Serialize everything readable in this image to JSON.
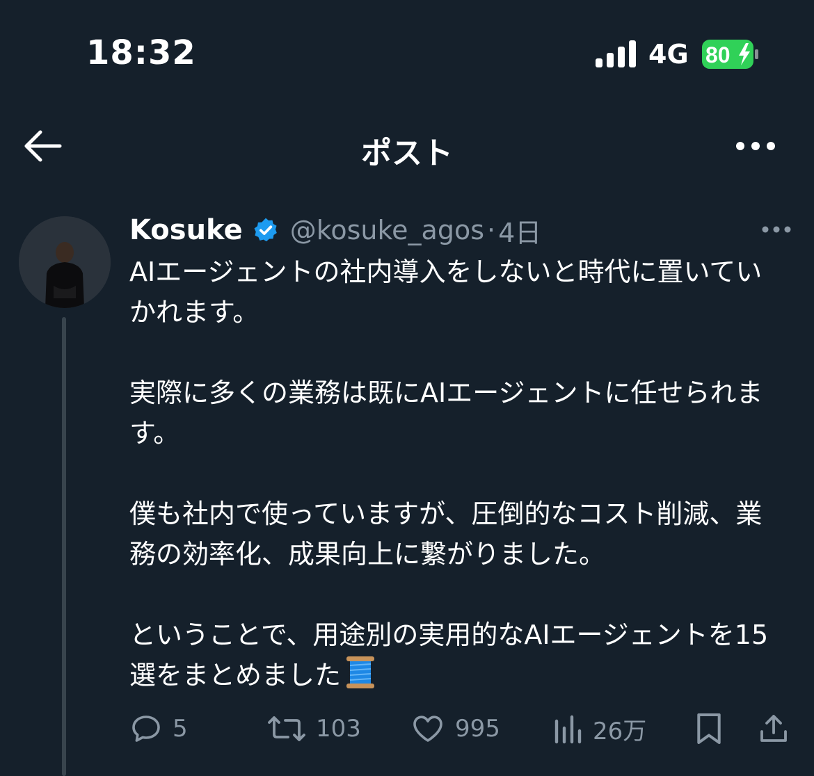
{
  "status_bar": {
    "time": "18:32",
    "network": "4G",
    "battery_level": "80",
    "battery_color": "#30d158"
  },
  "header": {
    "title": "ポスト",
    "back_icon": "arrow-left-icon",
    "more_icon": "more-horizontal-icon"
  },
  "post": {
    "author_name": "Kosuke",
    "verified_icon": "verified-badge-icon",
    "handle": "@kosuke_agos",
    "separator": "·",
    "timestamp": "4日",
    "paragraphs": [
      "AIエージェントの社内導入をしないと時代に置いていかれます。",
      "実際に多くの業務は既にAIエージェントに任せられます。",
      "僕も社内で使っていますが、圧倒的なコスト削減、業務の効率化、成果向上に繋がりました。",
      "ということで、用途別の実用的なAIエージェントを15選をまとめました"
    ],
    "emoji_icon": "thread-spool-icon",
    "accent_color": "#1d9bf0"
  },
  "actions": {
    "replies": "5",
    "reposts": "103",
    "likes": "995",
    "views": "26万"
  }
}
